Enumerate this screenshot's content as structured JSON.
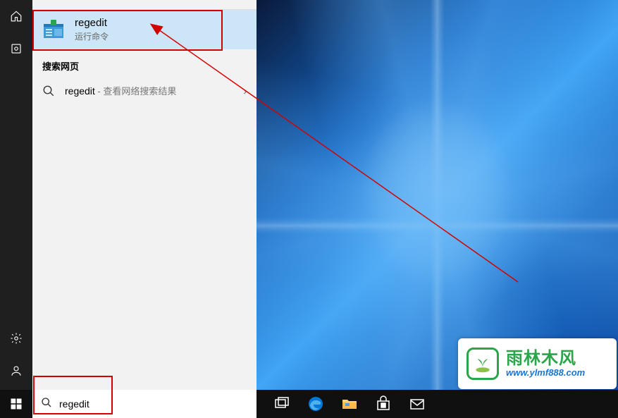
{
  "sidebar": {
    "icons": {
      "home": "home-icon",
      "recent": "recent-icon",
      "settings": "gear-icon",
      "account": "person-icon"
    }
  },
  "search_panel": {
    "best_match": {
      "title": "regedit",
      "subtitle": "运行命令"
    },
    "web_section_header": "搜索网页",
    "web_result": {
      "term": "regedit",
      "suffix": " - 查看网络搜索结果"
    }
  },
  "taskbar": {
    "search_value": "regedit"
  },
  "watermark": {
    "title": "雨林木风",
    "url": "www.ylmf888.com"
  },
  "colors": {
    "highlight_bg": "#cde6f7",
    "annotation_red": "#d40000",
    "accent_green": "#2aa54a",
    "accent_blue": "#1976d2"
  }
}
